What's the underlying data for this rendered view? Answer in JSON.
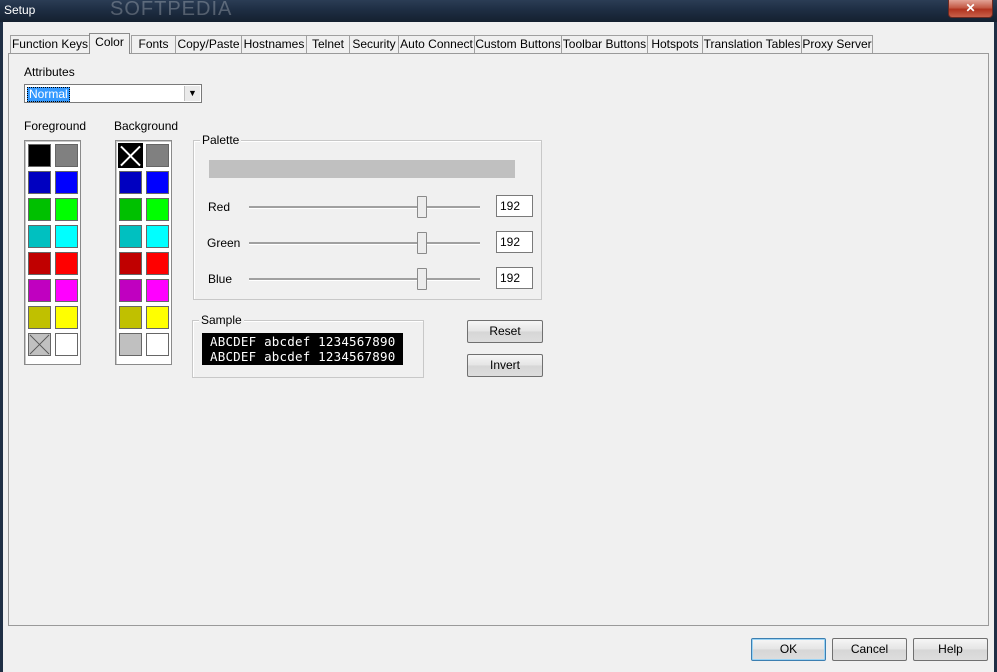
{
  "window": {
    "title": "Setup",
    "watermark": "SOFTPEDIA",
    "close_label": "✕"
  },
  "tabs": [
    {
      "label": "Function Keys"
    },
    {
      "label": "Color",
      "active": true
    },
    {
      "label": "Fonts"
    },
    {
      "label": "Copy/Paste"
    },
    {
      "label": "Hostnames"
    },
    {
      "label": "Telnet"
    },
    {
      "label": "Security"
    },
    {
      "label": "Auto Connect"
    },
    {
      "label": "Custom Buttons"
    },
    {
      "label": "Toolbar Buttons"
    },
    {
      "label": "Hotspots"
    },
    {
      "label": "Translation Tables"
    },
    {
      "label": "Proxy Server"
    }
  ],
  "attributes": {
    "label": "Attributes",
    "value": "Normal"
  },
  "foreground": {
    "label": "Foreground",
    "colors": [
      "#000000",
      "#808080",
      "#0000c0",
      "#0000ff",
      "#00c000",
      "#00ff00",
      "#00c0c0",
      "#00ffff",
      "#c00000",
      "#ff0000",
      "#c000c0",
      "#ff00ff",
      "#c0c000",
      "#ffff00",
      "#c0c0c0",
      "#ffffff"
    ],
    "special_index": 14
  },
  "background": {
    "label": "Background",
    "colors": [
      "#000000",
      "#808080",
      "#0000c0",
      "#0000ff",
      "#00c000",
      "#00ff00",
      "#00c0c0",
      "#00ffff",
      "#c00000",
      "#ff0000",
      "#c000c0",
      "#ff00ff",
      "#c0c000",
      "#ffff00",
      "#c0c0c0",
      "#ffffff"
    ],
    "selected_index": 0
  },
  "palette": {
    "title": "Palette",
    "preview_color": "#c0c0c0",
    "red": {
      "label": "Red",
      "value": "192",
      "level": 0.75
    },
    "green": {
      "label": "Green",
      "value": "192",
      "level": 0.75
    },
    "blue": {
      "label": "Blue",
      "value": "192",
      "level": 0.75
    }
  },
  "sample": {
    "title": "Sample",
    "line1": "ABCDEF abcdef 1234567890",
    "line2": "ABCDEF abcdef 1234567890"
  },
  "buttons": {
    "reset": "Reset",
    "invert": "Invert",
    "ok": "OK",
    "cancel": "Cancel",
    "help": "Help"
  }
}
